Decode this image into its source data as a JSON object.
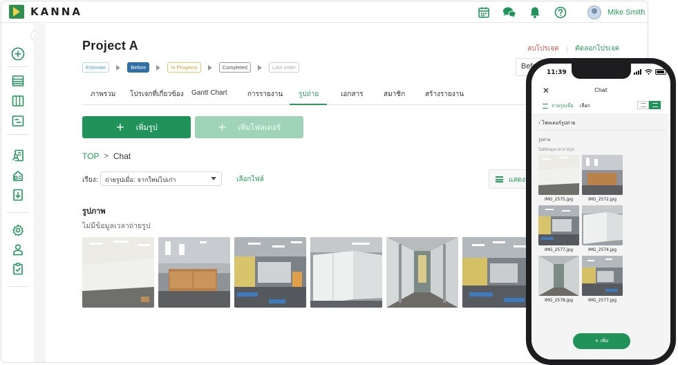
{
  "app": {
    "brand": "KANNA"
  },
  "header": {
    "icons": [
      "calendar-icon",
      "chat-icon",
      "bell-icon",
      "help-icon"
    ],
    "user_name": "Mike Smith"
  },
  "project": {
    "title": "Project A",
    "delete_label": "ลบโปรเจค",
    "copy_label": "คัดลอกโปรเจค",
    "status_steps": [
      "Estimate",
      "Before",
      "In Progress",
      "Completed",
      "Lost order"
    ],
    "active_step": "Before",
    "status_select_value": "Before"
  },
  "tabs": [
    "ภาพรวม",
    "โปรเจกที่เกี่ยวข้อง",
    "Gantt Chart",
    "การรายงาน",
    "รูปถ่าย",
    "เอกสาร",
    "สมาชิก",
    "สร้างรายงาน"
  ],
  "active_tab": "รูปถ่าย",
  "actions": {
    "add_photo": "เพิ่มรูป",
    "add_folder": "เพิ่มโฟลเดอร์"
  },
  "breadcrumb": {
    "root": "TOP",
    "current": "Chat"
  },
  "sort": {
    "label": "เรียง:",
    "value": "ถ่ายรูปเมื่อ: จากใหม่ไปเก่า",
    "select_files": "เลือกไฟล์"
  },
  "view_toggle_label": "แสดงรายการ",
  "gallery": {
    "title": "รูปภาพ",
    "subtitle": "ไม่มีข้อมูลเวลาถ่ายรูป"
  },
  "mobile": {
    "time": "11:39",
    "title": "Chat",
    "sort": "ถ่ายรูปเมื่อ",
    "select": "เลือก",
    "back": "โฟลเดอร์รูปถ่าย",
    "section": "รูปถ่าย",
    "no_date": "ไม่มีข้อมูลเวลาถ่ายรูป",
    "photos": [
      "IMG_2575.jpg",
      "IMG_2572.jpg",
      "IMG_2577.jpg",
      "IMG_2574.jpg",
      "IMG_2578.jpg",
      "IMG_2577.jpg"
    ],
    "add_button": "+ เพิ่ม"
  },
  "colors": {
    "accent": "#21935a",
    "delete": "#d9534f",
    "step_active": "#2f6fa3"
  }
}
